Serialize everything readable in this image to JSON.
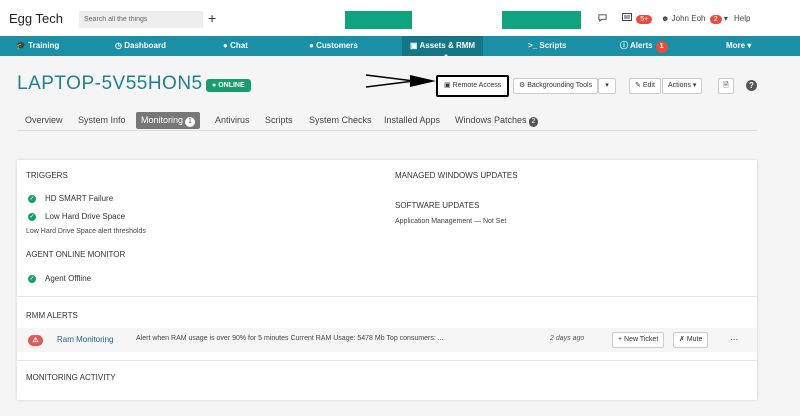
{
  "topbar": {
    "brand": "Egg Tech",
    "search_placeholder": "Search all the things",
    "plus": "+",
    "chat_icon": "chat-bubble-icon",
    "inbox_count": "5+",
    "user_name": "John Eoh",
    "user_badge": "2",
    "help": "Help"
  },
  "nav": {
    "items": [
      {
        "icon": "graduation-cap-icon",
        "label": "Training"
      },
      {
        "icon": "dashboard-icon",
        "label": "Dashboard"
      },
      {
        "icon": "chat-icon",
        "label": "Chat"
      },
      {
        "icon": "user-icon",
        "label": "Customers"
      },
      {
        "icon": "monitor-icon",
        "label": "Assets & RMM"
      },
      {
        "icon": "terminal-icon",
        "label": "Scripts"
      },
      {
        "icon": "alert-icon",
        "label": "Alerts",
        "badge": "1"
      },
      {
        "icon": "caret-down-icon",
        "label": "More"
      }
    ]
  },
  "header": {
    "title": "LAPTOP-5V55HON5",
    "status": "ONLINE",
    "remote_access": "Remote Access",
    "backgrounding_tools": "Backgrounding Tools",
    "edit": "Edit",
    "actions": "Actions",
    "help_symbol": "?"
  },
  "tabs": [
    {
      "label": "Overview"
    },
    {
      "label": "System Info"
    },
    {
      "label": "Monitoring",
      "count": "1"
    },
    {
      "label": "Antivirus"
    },
    {
      "label": "Scripts"
    },
    {
      "label": "System Checks"
    },
    {
      "label": "Installed Apps"
    },
    {
      "label": "Windows Patches",
      "count": "2"
    }
  ],
  "triggers": {
    "title": "TRIGGERS",
    "items": [
      "HD SMART Failure",
      "Low Hard Drive Space"
    ],
    "note": "Low Hard Drive Space alert thresholds"
  },
  "agent_monitor": {
    "title": "AGENT ONLINE MONITOR",
    "items": [
      "Agent Offline"
    ]
  },
  "managed_updates": {
    "title": "MANAGED WINDOWS UPDATES"
  },
  "software_updates": {
    "title": "SOFTWARE UPDATES",
    "value": "Application Management — Not Set"
  },
  "rmm_alerts": {
    "title": "RMM ALERTS",
    "rows": [
      {
        "name": "Ram Monitoring",
        "message": "Alert when RAM usage is over 90% for 5 minutes Current RAM Usage: 5478 Mb Top consumers: ...",
        "time": "2 days ago",
        "new_ticket": "+ New Ticket",
        "mute": "Mute",
        "more": "..."
      }
    ]
  },
  "monitoring_activity": {
    "title": "MONITORING ACTIVITY"
  },
  "colors": {
    "nav": "#1a8fa5",
    "title": "#1f7f94",
    "online": "#1a9d6c",
    "alert": "#e05a5a"
  }
}
